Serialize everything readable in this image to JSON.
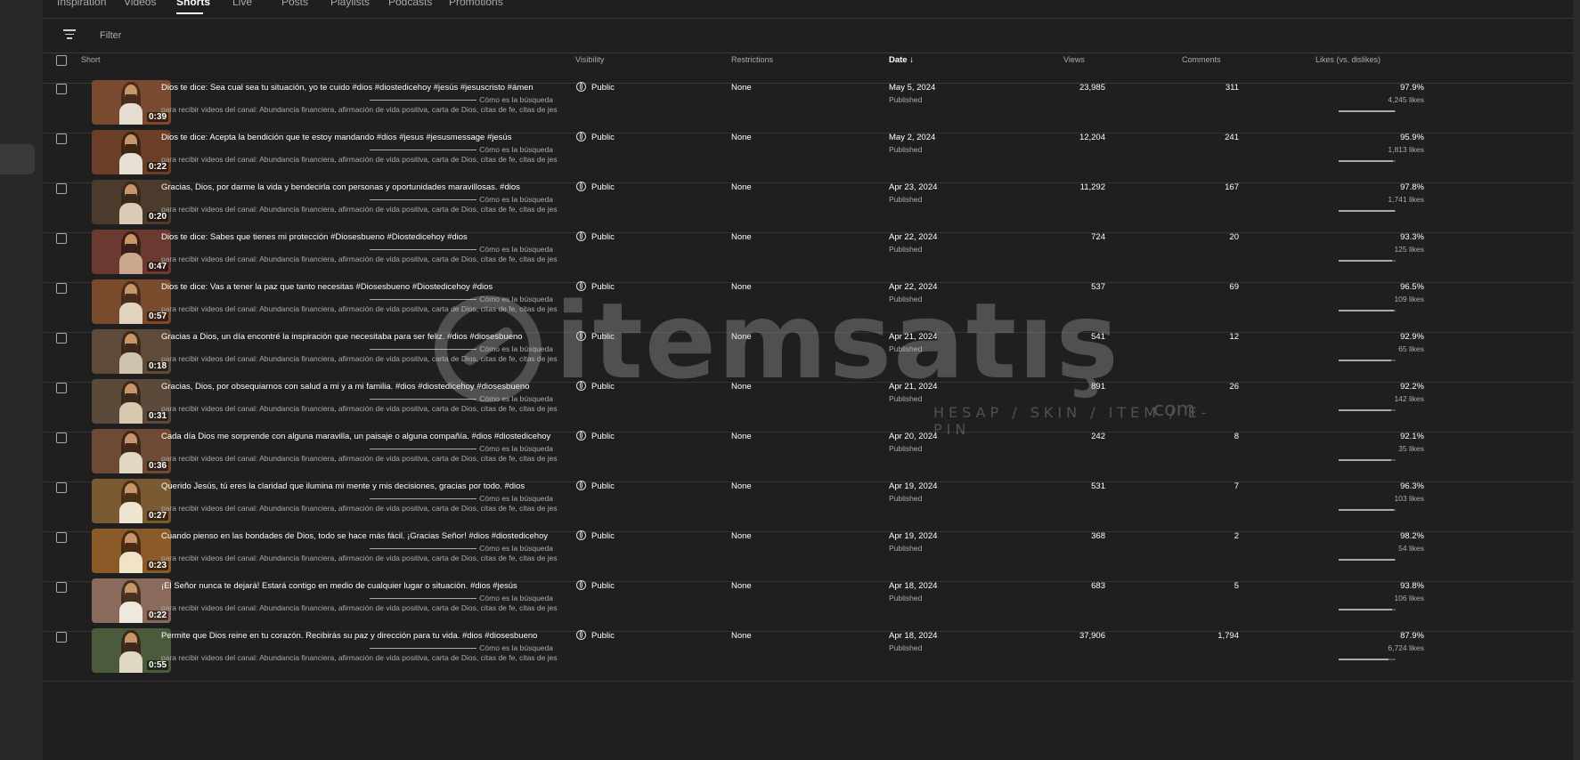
{
  "tabs": [
    "Inspiration",
    "Videos",
    "Shorts",
    "Live",
    "Posts",
    "Playlists",
    "Podcasts",
    "Promotions"
  ],
  "active_tab": "Shorts",
  "filter": {
    "placeholder": "Filter"
  },
  "columns": {
    "short": "Short",
    "visibility": "Visibility",
    "restrictions": "Restrictions",
    "date": "Date",
    "views": "Views",
    "comments": "Comments",
    "likes": "Likes (vs. dislikes)"
  },
  "description_line1": "Cómo es la búsqueda",
  "description_line2": "para recibir videos del canal: Abundancia financiera, afirmación de vida positiva, carta de Dios, citas de fe, citas de jesus...",
  "rows": [
    {
      "title": "Dios te dice: Sea cual sea tu situación, yo te cuido #dios #diostedicehoy #jesús #jesuscristo #ámen",
      "duration": "0:39",
      "visibility": "Public",
      "restrictions": "None",
      "date": "May 5, 2024",
      "status": "Published",
      "views": "23,985",
      "comments": "311",
      "likes_pct": "97.9%",
      "likes_count": "4,245 likes",
      "ratio": 0.979
    },
    {
      "title": "Dios te dice: Acepta la bendición que te estoy mandando #dios #jesus #jesusmessage #jesús",
      "duration": "0:22",
      "visibility": "Public",
      "restrictions": "None",
      "date": "May 2, 2024",
      "status": "Published",
      "views": "12,204",
      "comments": "241",
      "likes_pct": "95.9%",
      "likes_count": "1,813 likes",
      "ratio": 0.959
    },
    {
      "title": "Gracias, Dios, por darme la vida y bendecirla con personas y oportunidades maravillosas. #dios",
      "duration": "0:20",
      "visibility": "Public",
      "restrictions": "None",
      "date": "Apr 23, 2024",
      "status": "Published",
      "views": "11,292",
      "comments": "167",
      "likes_pct": "97.8%",
      "likes_count": "1,741 likes",
      "ratio": 0.978
    },
    {
      "title": "Dios te dice: Sabes que tienes mi protección #Diosesbueno #Diostedicehoy #dios",
      "duration": "0:47",
      "visibility": "Public",
      "restrictions": "None",
      "date": "Apr 22, 2024",
      "status": "Published",
      "views": "724",
      "comments": "20",
      "likes_pct": "93.3%",
      "likes_count": "125 likes",
      "ratio": 0.933
    },
    {
      "title": "Dios te dice: Vas a tener la paz que tanto necesitas #Diosesbueno #Diostedicehoy #dios",
      "duration": "0:57",
      "visibility": "Public",
      "restrictions": "None",
      "date": "Apr 22, 2024",
      "status": "Published",
      "views": "537",
      "comments": "69",
      "likes_pct": "96.5%",
      "likes_count": "109 likes",
      "ratio": 0.965
    },
    {
      "title": "Gracias a Dios, un día encontré la inspiración que necesitaba para ser feliz. #dios #diosesbueno",
      "duration": "0:18",
      "visibility": "Public",
      "restrictions": "None",
      "date": "Apr 21, 2024",
      "status": "Published",
      "views": "541",
      "comments": "12",
      "likes_pct": "92.9%",
      "likes_count": "65 likes",
      "ratio": 0.929
    },
    {
      "title": "Gracias, Dios, por obsequiarnos con salud a mi y a mi familia. #dios #diostedicehoy #diosesbueno",
      "duration": "0:31",
      "visibility": "Public",
      "restrictions": "None",
      "date": "Apr 21, 2024",
      "status": "Published",
      "views": "891",
      "comments": "26",
      "likes_pct": "92.2%",
      "likes_count": "142 likes",
      "ratio": 0.922
    },
    {
      "title": "Cada día Dios me sorprende con alguna maravilla, un paisaje o alguna compañía. #dios #diostedicehoy",
      "duration": "0:36",
      "visibility": "Public",
      "restrictions": "None",
      "date": "Apr 20, 2024",
      "status": "Published",
      "views": "242",
      "comments": "8",
      "likes_pct": "92.1%",
      "likes_count": "35 likes",
      "ratio": 0.921
    },
    {
      "title": "Querido Jesús, tú eres la claridad que ilumina mi mente y mis decisiones, gracias por todo. #dios",
      "duration": "0:27",
      "visibility": "Public",
      "restrictions": "None",
      "date": "Apr 19, 2024",
      "status": "Published",
      "views": "531",
      "comments": "7",
      "likes_pct": "96.3%",
      "likes_count": "103 likes",
      "ratio": 0.963
    },
    {
      "title": "Cuando pienso en las bondades de Dios, todo se hace más fácil. ¡Gracias Señor! #dios #diostedicehoy",
      "duration": "0:23",
      "visibility": "Public",
      "restrictions": "None",
      "date": "Apr 19, 2024",
      "status": "Published",
      "views": "368",
      "comments": "2",
      "likes_pct": "98.2%",
      "likes_count": "54 likes",
      "ratio": 0.982
    },
    {
      "title": "¡El Señor nunca te dejará! Estará contigo en medio de cualquier lugar o situación. #dios #jesús",
      "duration": "0:22",
      "visibility": "Public",
      "restrictions": "None",
      "date": "Apr 18, 2024",
      "status": "Published",
      "views": "683",
      "comments": "5",
      "likes_pct": "93.8%",
      "likes_count": "106 likes",
      "ratio": 0.938
    },
    {
      "title": "Permite que Dios reine en tu corazón. Recibirás su paz y dirección para tu vida. #dios #diosesbueno",
      "duration": "0:55",
      "visibility": "Public",
      "restrictions": "None",
      "date": "Apr 18, 2024",
      "status": "Published",
      "views": "37,906",
      "comments": "1,794",
      "likes_pct": "87.9%",
      "likes_count": "6,724 likes",
      "ratio": 0.879
    }
  ],
  "watermark": {
    "brand": "itemsatış",
    "tagline": "HESAP / SKIN / ITEM / E-PIN",
    "suffix": ".com"
  },
  "colors": {
    "background": "#1f1f1f",
    "sidebar": "#282828",
    "text": "#f1f1f1",
    "muted": "#aaaaaa"
  },
  "icons": {
    "filter": "filter-icon",
    "sort": "arrow-down-icon",
    "visibility": "globe-icon"
  }
}
